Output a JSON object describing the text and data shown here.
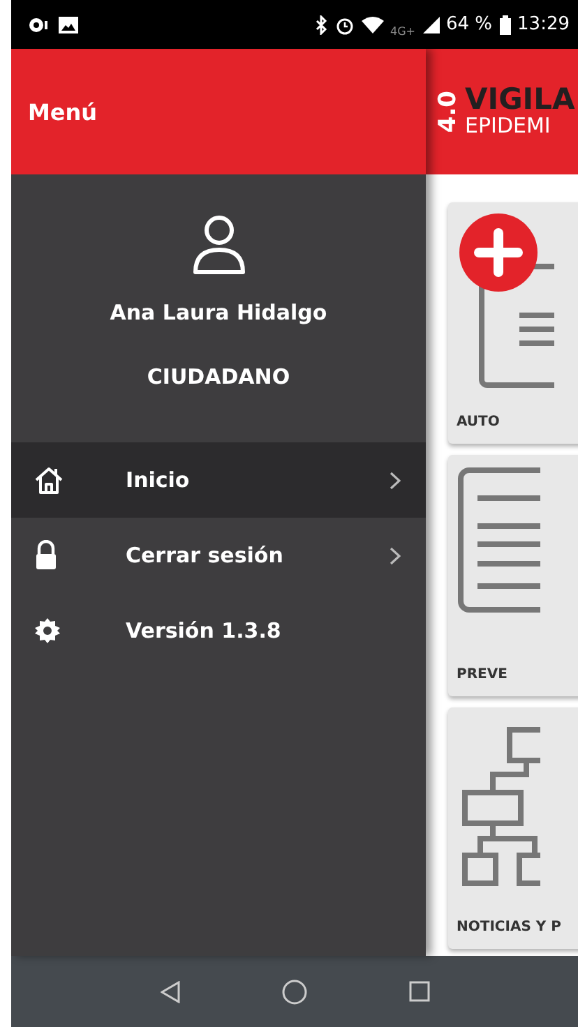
{
  "status_bar": {
    "battery": "64 %",
    "time": "13:29",
    "network": "4G+"
  },
  "drawer": {
    "title": "Menú",
    "user": {
      "name": "Ana Laura Hidalgo",
      "role": "CIUDADANO"
    },
    "items": [
      {
        "label": "Inicio",
        "kind": "link",
        "selected": true
      },
      {
        "label": "Cerrar sesión",
        "kind": "link",
        "selected": false
      },
      {
        "label": "Versión 1.3.8",
        "kind": "info",
        "selected": false
      }
    ]
  },
  "app": {
    "logo": {
      "badge": "4.0",
      "title": "VIGILA",
      "subtitle": "EPIDEMI"
    },
    "cards": [
      {
        "label": "AUTO"
      },
      {
        "label": "PREVE"
      },
      {
        "label": "NOTICIAS Y P"
      }
    ]
  }
}
